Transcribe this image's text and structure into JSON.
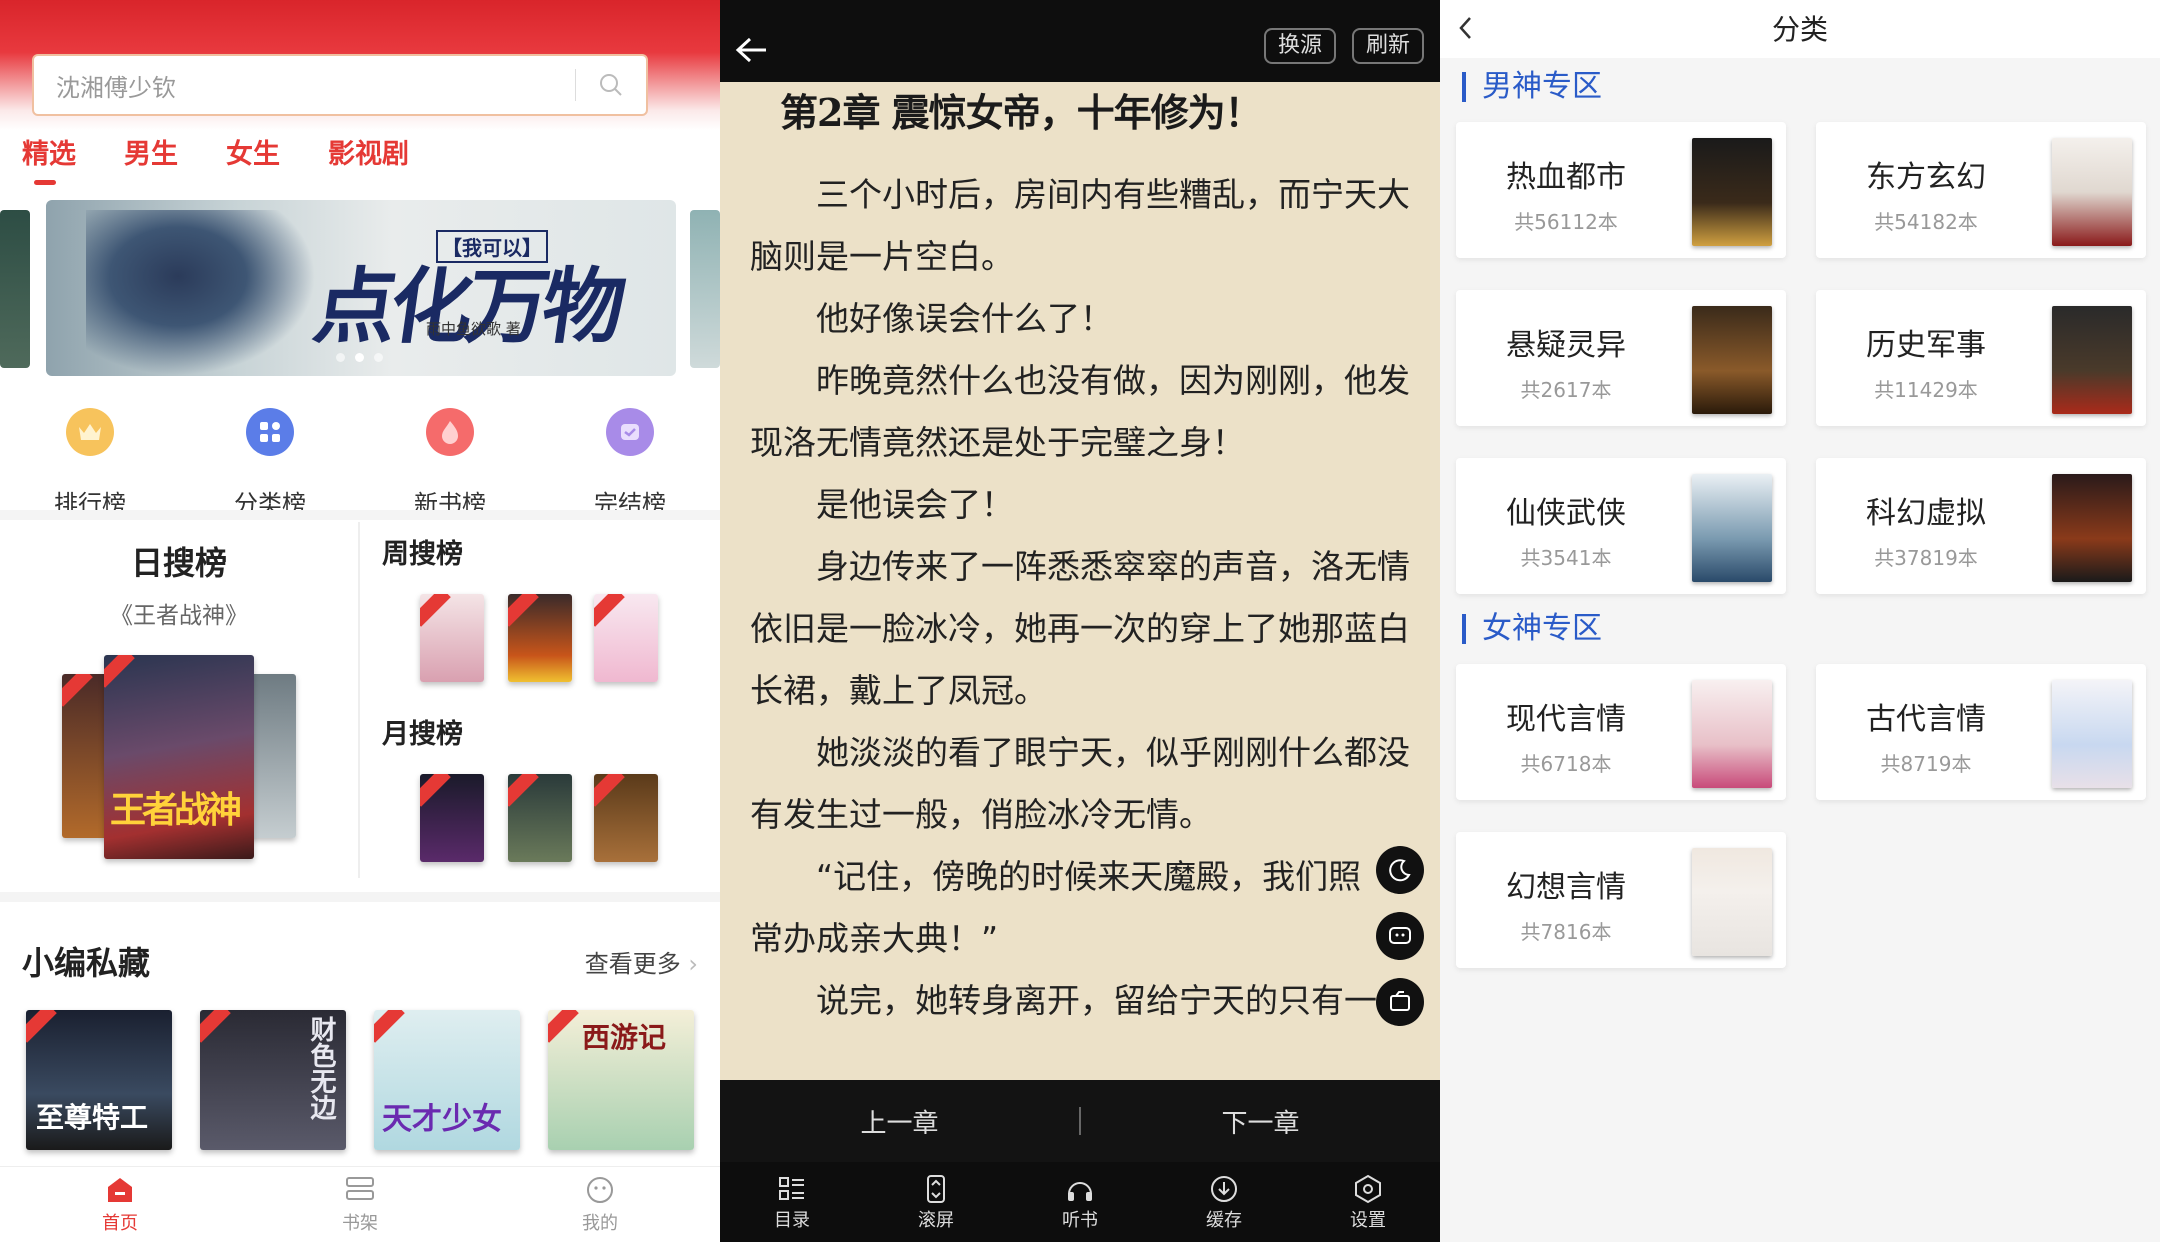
{
  "home": {
    "search": {
      "placeholder": "沈湘傅少钦"
    },
    "tabs": [
      {
        "label": "精选"
      },
      {
        "label": "男生"
      },
      {
        "label": "女生"
      },
      {
        "label": "影视剧"
      }
    ],
    "banner": {
      "tag": "【我可以】",
      "title": "点化万物",
      "author": "雨中鱼欲歌 著"
    },
    "quick": [
      {
        "label": "排行榜"
      },
      {
        "label": "分类榜"
      },
      {
        "label": "新书榜"
      },
      {
        "label": "完结榜"
      }
    ],
    "daily": {
      "title": "日搜榜",
      "book": "《王者战神》",
      "cover_text": "王者战神"
    },
    "weekly": {
      "title": "周搜榜"
    },
    "monthly": {
      "title": "月搜榜"
    },
    "picks": {
      "title": "小编私藏",
      "more": "查看更多"
    },
    "pick_covers": [
      "至尊特工",
      "财色无边",
      "天才少女",
      "西游记"
    ],
    "nav": [
      {
        "label": "首页"
      },
      {
        "label": "书架"
      },
      {
        "label": "我的"
      }
    ],
    "accent": "#e53935"
  },
  "reader": {
    "buttons": {
      "source": "换源",
      "refresh": "刷新"
    },
    "chapter_title": "第2章 震惊女帝，十年修为！",
    "paragraphs": [
      "三个小时后，房间内有些糟乱，而宁天大脑则是一片空白。",
      "他好像误会什么了！",
      "昨晚竟然什么也没有做，因为刚刚，他发现洛无情竟然还是处于完璧之身！",
      "是他误会了！",
      "身边传来了一阵悉悉窣窣的声音，洛无情依旧是一脸冰冷，她再一次的穿上了她那蓝白长裙，戴上了凤冠。",
      "她淡淡的看了眼宁天，似乎刚刚什么都没有发生过一般，俏脸冰冷无情。",
      "“记住，傍晚的时候来天魔殿，我们照常办成亲大典！”",
      "说完，她转身离开，留给宁天的只有一"
    ],
    "prev": "上一章",
    "next": "下一章",
    "toolbar": [
      {
        "label": "目录"
      },
      {
        "label": "滚屏"
      },
      {
        "label": "听书"
      },
      {
        "label": "缓存"
      },
      {
        "label": "设置"
      }
    ],
    "bg": "#ece1c8"
  },
  "category": {
    "title": "分类",
    "male_zone": "男神专区",
    "female_zone": "女神专区",
    "male": [
      {
        "name": "热血都市",
        "count": "共56112本"
      },
      {
        "name": "东方玄幻",
        "count": "共54182本"
      },
      {
        "name": "悬疑灵异",
        "count": "共2617本"
      },
      {
        "name": "历史军事",
        "count": "共11429本"
      },
      {
        "name": "仙侠武侠",
        "count": "共3541本"
      },
      {
        "name": "科幻虚拟",
        "count": "共37819本"
      }
    ],
    "female": [
      {
        "name": "现代言情",
        "count": "共6718本"
      },
      {
        "name": "古代言情",
        "count": "共8719本"
      },
      {
        "name": "幻想言情",
        "count": "共7816本"
      }
    ],
    "zone_color": "#2a5bc8"
  }
}
